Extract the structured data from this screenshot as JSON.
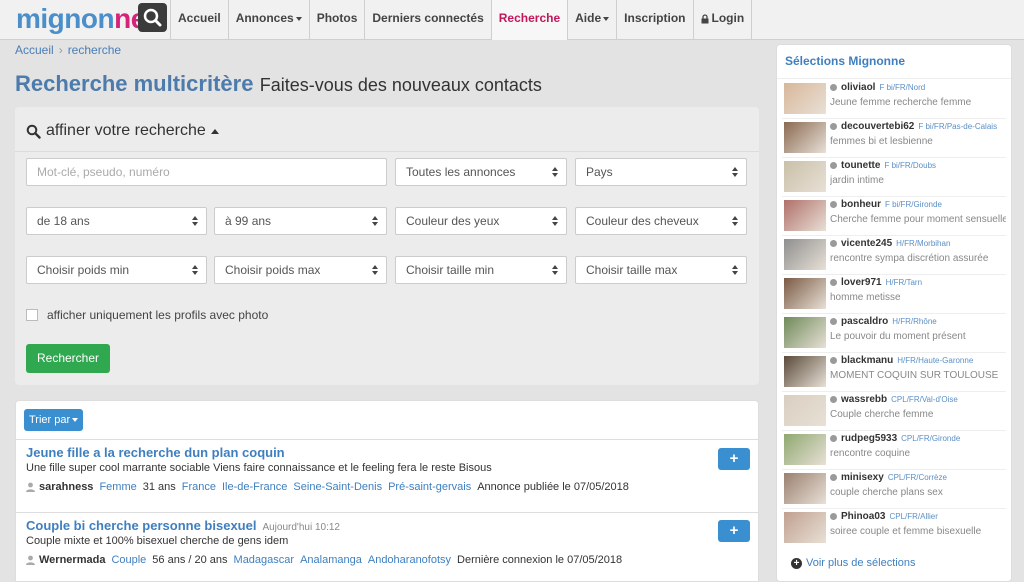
{
  "navbar": {
    "logo_part1": "mignon",
    "logo_part2": "ne",
    "items": [
      {
        "label": "Accueil",
        "caret": false
      },
      {
        "label": "Annonces",
        "caret": true
      },
      {
        "label": "Photos",
        "caret": false
      },
      {
        "label": "Derniers connectés",
        "caret": false
      },
      {
        "label": "Recherche",
        "caret": false,
        "active": true
      },
      {
        "label": "Aide",
        "caret": true
      },
      {
        "label": "Inscription",
        "caret": false
      },
      {
        "label": "Login",
        "caret": false
      }
    ]
  },
  "breadcrumb": {
    "home": "Accueil",
    "current": "recherche"
  },
  "page": {
    "title": "Recherche multicritère",
    "subtitle": "Faites-vous des nouveaux contacts"
  },
  "search": {
    "refine_label": "affiner votre recherche",
    "keyword_placeholder": "Mot-clé, pseudo, numéro",
    "ad_type": "Toutes les annonces",
    "country": "Pays",
    "age_min": "de 18 ans",
    "age_max": "à 99 ans",
    "eye_color": "Couleur des yeux",
    "hair_color": "Couleur des cheveux",
    "weight_min": "Choisir poids min",
    "weight_max": "Choisir poids max",
    "height_min": "Choisir taille min",
    "height_max": "Choisir taille max",
    "photo_only_label": "afficher uniquement les profils avec photo",
    "submit_label": "Rechercher"
  },
  "results": {
    "sort_label": "Trier par",
    "plus_label": "+",
    "items": [
      {
        "title": "Jeune fille a la recherche dun plan coquin",
        "time": "",
        "description": "Une fille super cool marrante sociable Viens faire connaissance et le feeling fera le reste Bisous",
        "pseudo": "sarahness",
        "type": "Femme",
        "age": "31 ans",
        "country": "France",
        "region": "Ile-de-France",
        "department": "Seine-Saint-Denis",
        "city": "Pré-saint-gervais",
        "date_text": "Annonce publiée le 07/05/2018"
      },
      {
        "title": "Couple bi cherche personne bisexuel",
        "time": "Aujourd'hui 10:12",
        "description": "Couple mixte et 100% bisexuel cherche de gens idem",
        "pseudo": "Wernermada",
        "type": "Couple",
        "age": "56 ans / 20 ans",
        "country": "Madagascar",
        "region": "Analamanga",
        "department": "Andoharanofotsy",
        "city": "",
        "date_text": "Dernière connexion le 07/05/2018"
      }
    ]
  },
  "sidebar": {
    "title": "Sélections Mignonne",
    "more_label": "Voir plus de sélections",
    "items": [
      {
        "name": "oliviaol",
        "tags": "F bi/FR/Nord",
        "text": "Jeune femme recherche femme",
        "color": "#d8b79a"
      },
      {
        "name": "decouvertebi62",
        "tags": "F bi/FR/Pas-de-Calais",
        "text": "femmes bi et lesbienne",
        "color": "#8a6a52"
      },
      {
        "name": "tounette",
        "tags": "F bi/FR/Doubs",
        "text": "jardin intime",
        "color": "#c9c0a8"
      },
      {
        "name": "bonheur",
        "tags": "F bi/FR/Gironde",
        "text": "Cherche femme pour moment sensuelle ...",
        "color": "#b0706a"
      },
      {
        "name": "vicente245",
        "tags": "H/FR/Morbihan",
        "text": "rencontre sympa discrétion assurée",
        "color": "#8f8f8f"
      },
      {
        "name": "lover971",
        "tags": "H/FR/Tarn",
        "text": "homme metisse",
        "color": "#7a5a45"
      },
      {
        "name": "pascaldro",
        "tags": "H/FR/Rhône",
        "text": "Le pouvoir du moment présent",
        "color": "#6f8a5a"
      },
      {
        "name": "blackmanu",
        "tags": "H/FR/Haute-Garonne",
        "text": "MOMENT COQUIN SUR TOULOUSE",
        "color": "#5a4a3a"
      },
      {
        "name": "wassrebb",
        "tags": "CPL/FR/Val-d'Oise",
        "text": "Couple cherche femme",
        "color": "#d9cfc0"
      },
      {
        "name": "rudpeg5933",
        "tags": "CPL/FR/Gironde",
        "text": "rencontre coquine",
        "color": "#8fa870"
      },
      {
        "name": "minisexy",
        "tags": "CPL/FR/Corrèze",
        "text": "couple cherche plans sex",
        "color": "#9a8070"
      },
      {
        "name": "Phinoa03",
        "tags": "CPL/FR/Allier",
        "text": "soiree couple et femme bisexuelle",
        "color": "#c0a090"
      }
    ]
  }
}
